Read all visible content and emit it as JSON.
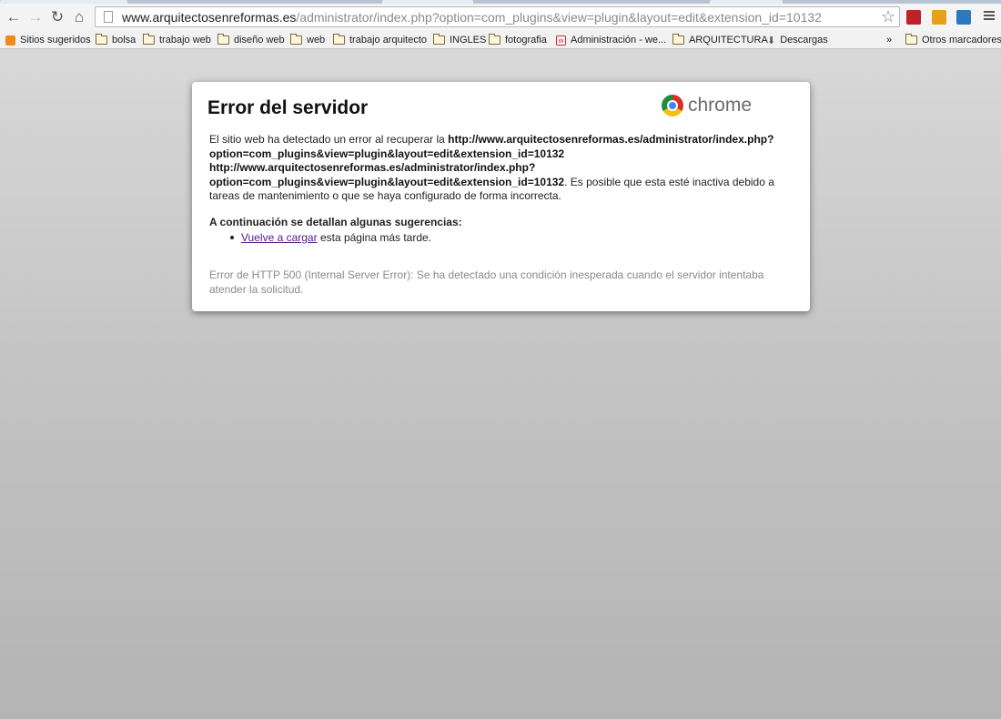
{
  "browser": {
    "url_host": "www.arquitectosenreformas.es",
    "url_path": "/administrator/index.php?option=com_plugins&view=plugin&layout=edit&extension_id=10132",
    "bookmarks": [
      {
        "label": "Sitios sugeridos",
        "icon": "suggested-sites-icon"
      },
      {
        "label": "bolsa",
        "icon": "folder-icon"
      },
      {
        "label": "trabajo web",
        "icon": "folder-icon"
      },
      {
        "label": "diseño web",
        "icon": "folder-icon"
      },
      {
        "label": "web",
        "icon": "folder-icon"
      },
      {
        "label": "trabajo arquitecto",
        "icon": "folder-icon"
      },
      {
        "label": "INGLES",
        "icon": "folder-icon"
      },
      {
        "label": "fotografia",
        "icon": "folder-icon"
      },
      {
        "label": "Administración - we...",
        "icon": "site-favicon"
      },
      {
        "label": "ARQUITECTURA",
        "icon": "folder-icon"
      },
      {
        "label": "Descargas",
        "icon": "download-icon"
      }
    ],
    "overflow_label": "»",
    "other_bookmarks": "Otros marcadores",
    "ext_colors": [
      "#c0202a",
      "#e8a01a",
      "#2a7ac0"
    ]
  },
  "error_page": {
    "title": "Error del servidor",
    "logo_text": "chrome",
    "msg_intro": "El sitio web ha detectado un error al recuperar la ",
    "msg_url": "http://www.arquitectosenreformas.es/administrator/index.php?option=com_plugins&view=plugin&layout=edit&extension_id=10132 http://www.arquitectosenreformas.es/administrator/index.php?option=com_plugins&view=plugin&layout=edit&extension_id=10132",
    "msg_tail": ". Es posible que esta esté inactiva debido a tareas de mantenimiento o que se haya configurado de forma incorrecta.",
    "suggestions_title": "A continuación se detallan algunas sugerencias:",
    "reload_link": "Vuelve a cargar",
    "reload_tail": " esta página más tarde.",
    "http_error": "Error de HTTP 500 (Internal Server Error): Se ha detectado una condición inesperada cuando el servidor intentaba atender la solicitud."
  }
}
